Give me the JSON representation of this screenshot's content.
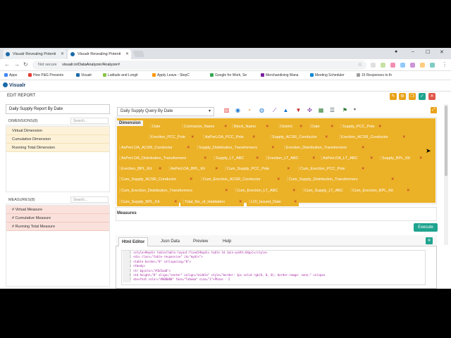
{
  "browser": {
    "tabs": [
      {
        "title": "Visualr Revealing Potenti",
        "active": false
      },
      {
        "title": "Visualr Revealing Potenti",
        "active": true
      }
    ],
    "security_label": "Not secure",
    "url": "visualr.in/DataAnalyzer/Analyzer#",
    "bookmarks": [
      "Apps",
      "How P&G Presents",
      "Visualr",
      "Latitude and Longit",
      "Apply Leave - StepC",
      "Google for Work, Se",
      "Merchandising Mana",
      "Meeting Scheduler",
      "15 Responses to th"
    ]
  },
  "app": {
    "logo": "Visualr",
    "page_title": "EDIT REPORT",
    "report_name": "Daily Supply Report By Date",
    "dimensions_header": "DIMENSIONS(8)",
    "measures_header": "MEASURES(8)",
    "search_placeholder": "Search...",
    "dimensions": [
      "Virtual Dimension",
      "Cumulative Dimension",
      "Running Total Dimension"
    ],
    "measures": [
      "# Virtual Measure",
      "# Cumulative Measure",
      "# Running Total Measure"
    ],
    "query_select": "Daily Supply Query By Date",
    "dimension_zone_label": "Dimension",
    "measures_zone_label": "Measures",
    "execute_label": "Execute",
    "pills": [
      "Date",
      "Contractor_Name",
      "Block_Name",
      "District",
      "Date",
      "Supply_PCC_Pole",
      "Erection_PCC_Pole",
      "AsPerLOA_PCC_Pole",
      "Supply_ACSR_Conductor",
      "Erection_ACSR_Conductor",
      "AsPerLOA_ACSR_Conductor",
      "Supply_Distribution_Transformers",
      "Erection_Distribution_Transformers",
      "AsPerLOA_Distribution_Transformers",
      "Supply_LT_ABC",
      "Erection_LT_ABC",
      "AsPerLOA_LT_ABC",
      "Supply_BPL_Kit",
      "Erection_BPL_Kit",
      "AsPerLOA_BPL_Kit",
      "Cum_Supply_PCC_Pole",
      "Cum_Erection_PCC_Pole",
      "Cum_Supply_ACSR_Conductor",
      "Cum_Erection_ACSR_Conductor",
      "Cum_Supply_Distribution_Transformers",
      "Cum_Erection_Distribution_Transformers",
      "Cum_Erection_LT_ABC",
      "Cum_Supply_LT_ABC",
      "Cum_Erection_BPL_Kit",
      "Cum_Supply_BPL_Kit",
      "Total_No_of_Habitation",
      "LOI_Issued_Date"
    ],
    "editor_tabs": [
      "Html Editor",
      "Json Data",
      "Preview",
      "Help"
    ],
    "code_lines": [
      {
        "n": "1",
        "text": "<style>#mydiv table{table-layout:fixed}#mydiv table td {min-width:64px}</style>"
      },
      {
        "n": "2",
        "text": "<div class=\"table-responsive\" id=\"mydiv\">"
      },
      {
        "n": "3",
        "text": "    <table border=\"0\" cellspacing=\"0\">"
      },
      {
        "n": "4",
        "text": "      <tbody>"
      },
      {
        "n": "5",
        "text": "        <tr bgcolor=\"#1b5aa0\">"
      },
      {
        "n": "6",
        "text": "          <td height=\"8\" align=\"center\" valign=\"middle\" style=\"border: 1px solid rgb(0, 0, 0); border-image: none;\" colspan"
      },
      {
        "n": "7",
        "text": "            <b><font color=\"#000000\" face=\"Tahoma\" size=\"1\">Phase - I"
      }
    ]
  },
  "colors": {
    "pill": "#ebb127",
    "accent": "#1fa48f",
    "dimension_bg": "#fdf2d8",
    "measure_bg": "#fbe1dc"
  }
}
